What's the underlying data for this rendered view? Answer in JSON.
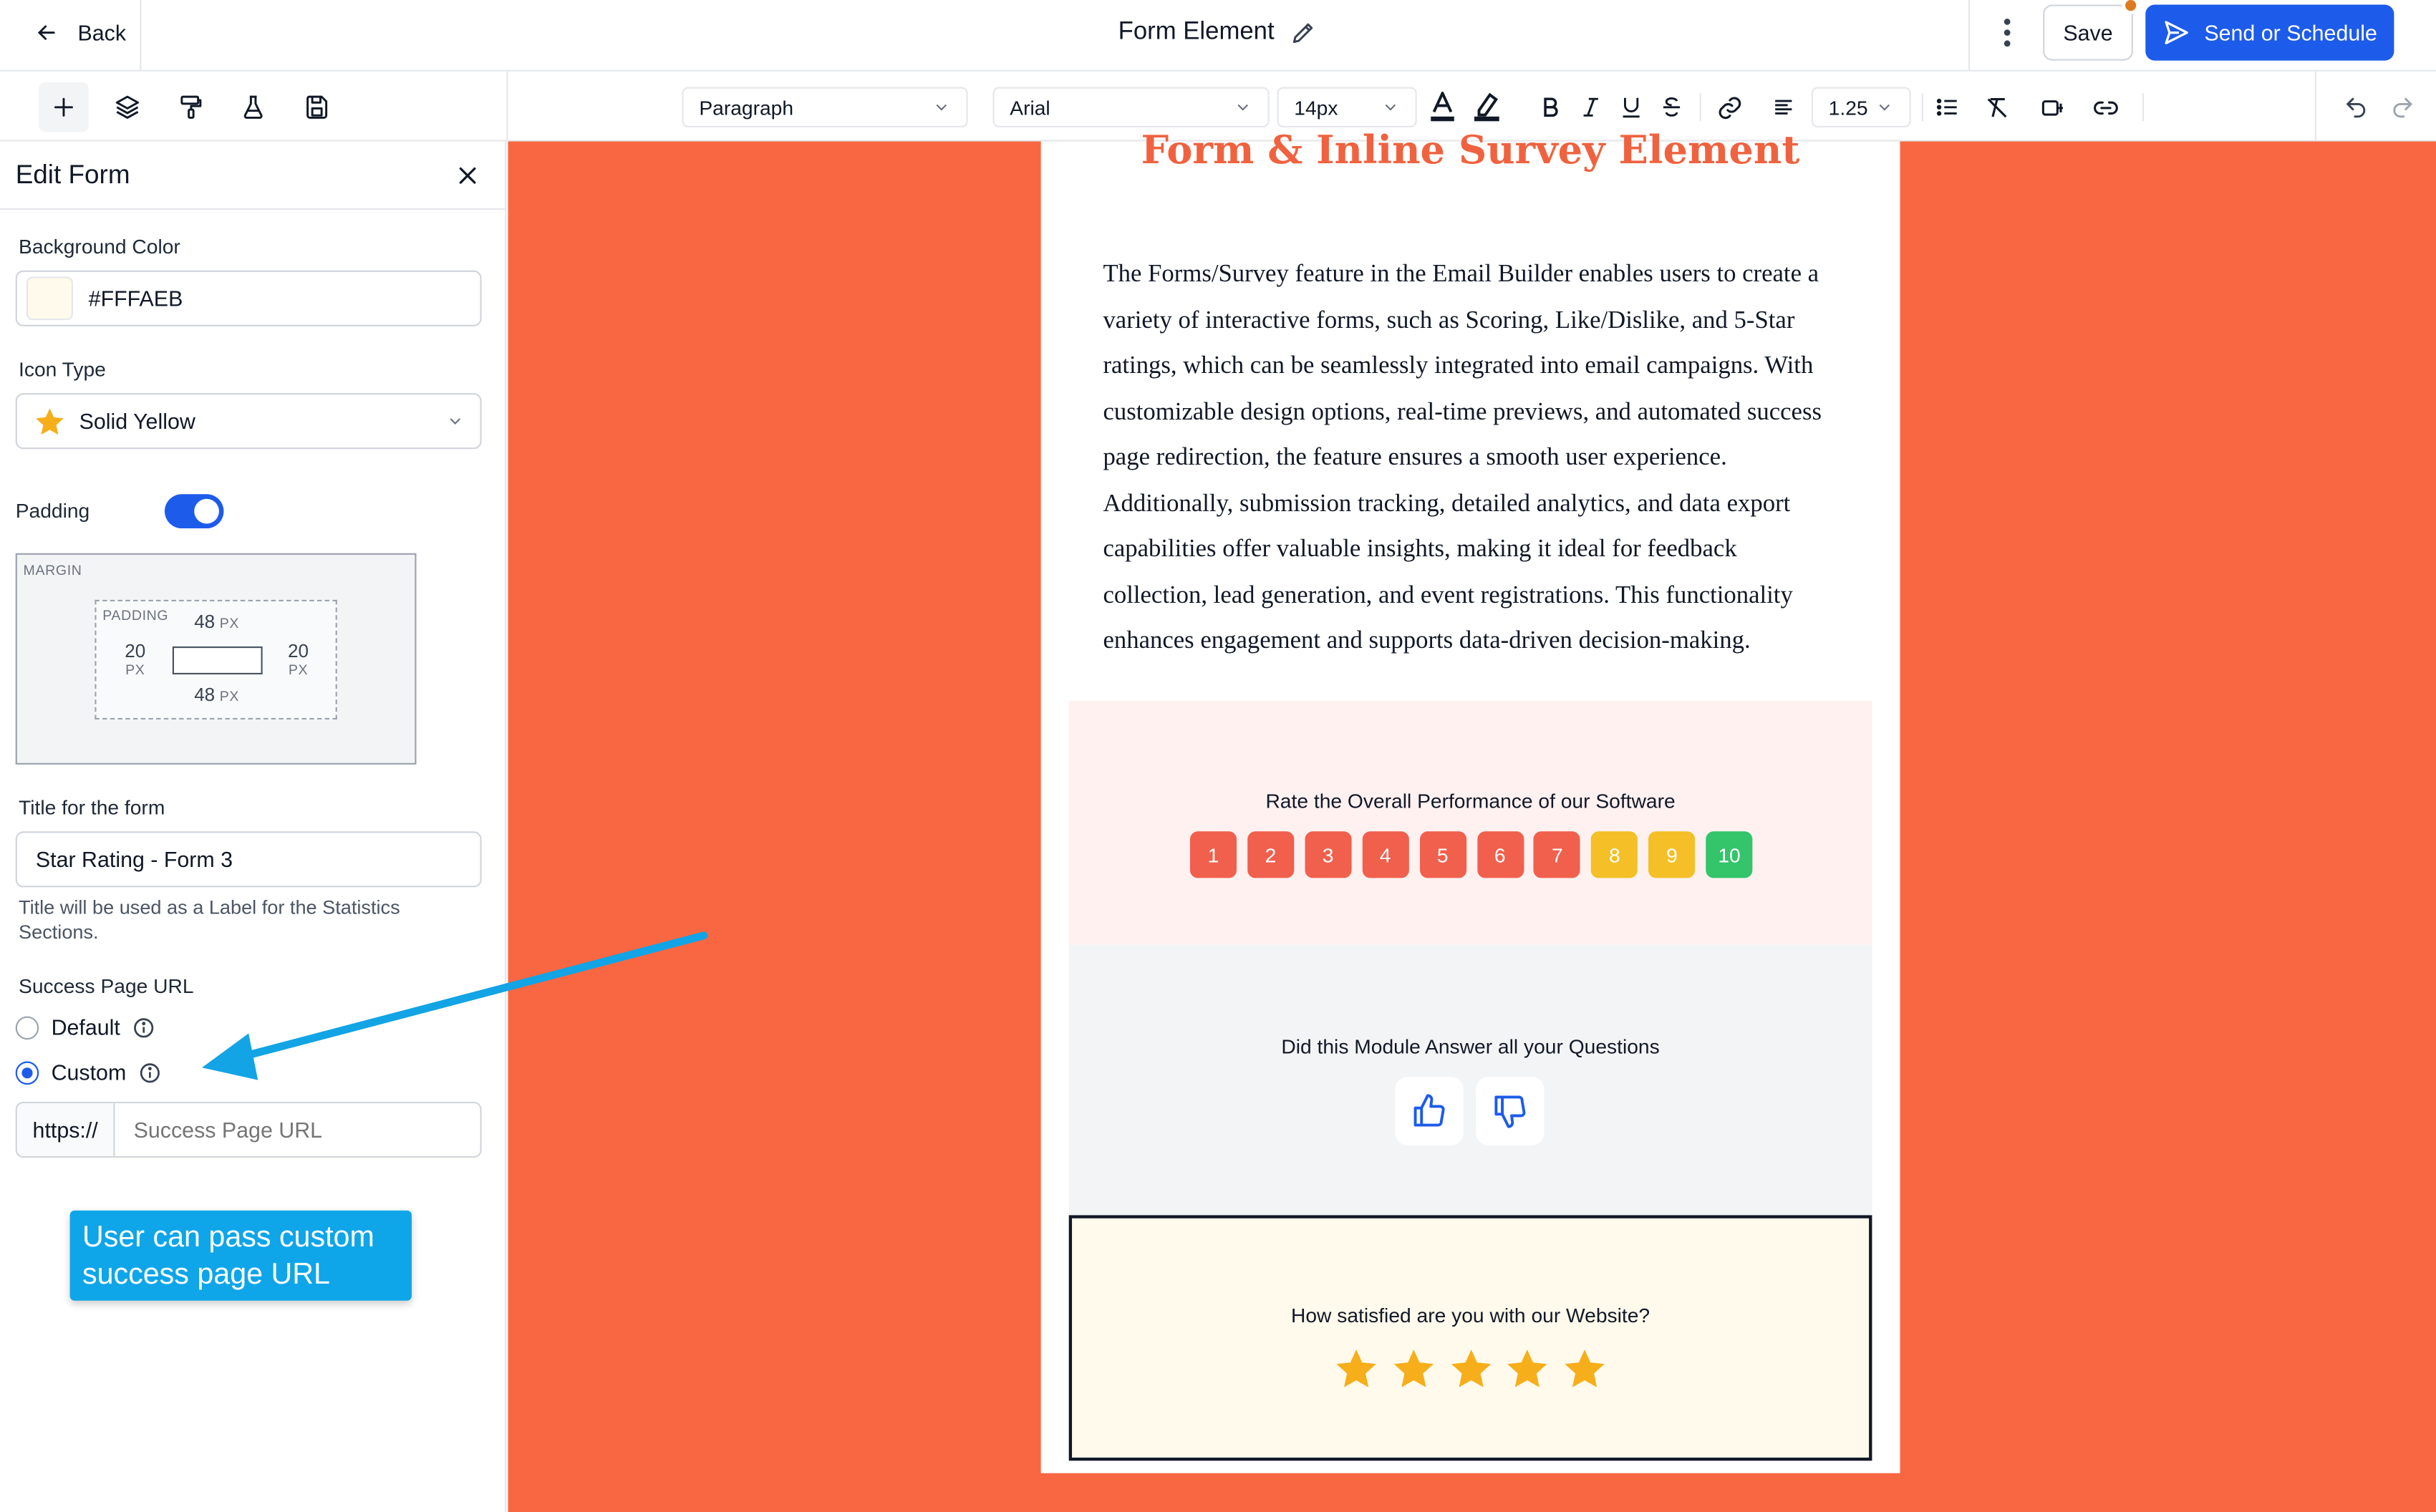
{
  "header": {
    "back_label": "Back",
    "title": "Form Element",
    "save_label": "Save",
    "send_label": "Send or Schedule"
  },
  "toolbar": {
    "block_type": "Paragraph",
    "font_family": "Arial",
    "font_size": "14px",
    "line_height": "1.25"
  },
  "sidebar": {
    "title": "Edit Form",
    "background_color_label": "Background Color",
    "background_color_value": "#FFFAEB",
    "icon_type_label": "Icon Type",
    "icon_type_value": "Solid Yellow",
    "padding_label": "Padding",
    "padding_enabled": true,
    "margin_label": "MARGIN",
    "padding_box_label": "PADDING",
    "padding_top": "48",
    "padding_bottom": "48",
    "padding_left": "20",
    "padding_right": "20",
    "unit": "PX",
    "form_title_label": "Title for the form",
    "form_title_value": "Star Rating - Form 3",
    "form_title_help": "Title will be used as a Label for the Statistics Sections.",
    "success_url_label": "Success Page URL",
    "option_default": "Default",
    "option_custom": "Custom",
    "selected_option": "Custom",
    "url_prefix": "https://",
    "url_placeholder": "Success Page URL"
  },
  "annotation": {
    "callout_text": "User can pass custom success page URL"
  },
  "email": {
    "heading": "Form & Inline Survey Element",
    "paragraph": "The Forms/Survey feature in the Email Builder enables users to create a variety of interactive forms, such as Scoring, Like/Dislike, and 5-Star ratings, which can be seamlessly integrated into email campaigns. With customizable design options, real-time previews, and automated success page redirection, the feature ensures a smooth user experience. Additionally, submission tracking, detailed analytics, and data export capabilities offer valuable insights, making it ideal for feedback collection, lead generation, and event registrations. This functionality enhances engagement and supports data-driven decision-making.",
    "score_question": "Rate the Overall Performance of our Software",
    "score_buttons": [
      "1",
      "2",
      "3",
      "4",
      "5",
      "6",
      "7",
      "8",
      "9",
      "10"
    ],
    "score_colors": [
      "#f0604d",
      "#f0604d",
      "#f0604d",
      "#f0604d",
      "#f0604d",
      "#f0604d",
      "#f0604d",
      "#f4bf27",
      "#f4bf27",
      "#34c46a"
    ],
    "like_question": "Did this Module Answer all your Questions",
    "star_question": "How satisfied are you with our Website?",
    "star_count": 5
  },
  "colors": {
    "accent": "#1D5BEA",
    "canvas_bg": "#F96742",
    "heading_color": "#F0623F",
    "score_section_bg": "#FFF1F0",
    "like_section_bg": "#F3F4F6",
    "star_section_bg": "#FFFAEB",
    "star_color": "#F6AE1B",
    "callout_bg": "#0EA5E9"
  }
}
